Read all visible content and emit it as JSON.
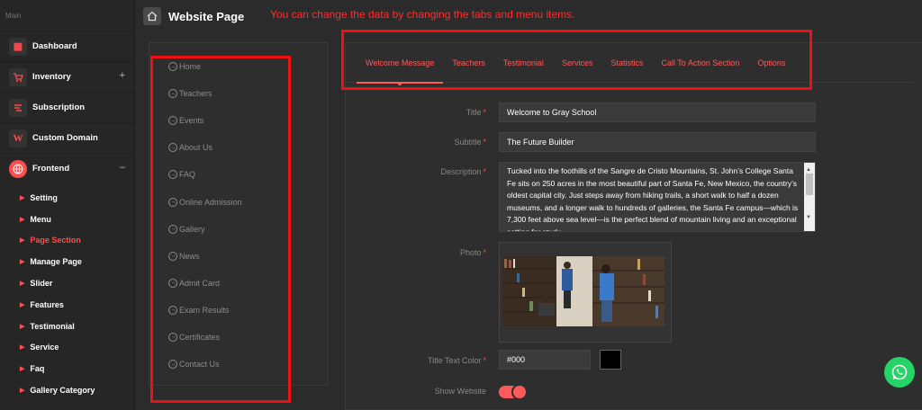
{
  "sidebar": {
    "section_label": "Main",
    "items": [
      {
        "label": "Dashboard",
        "icon": "dashboard-icon",
        "glyph": "▦"
      },
      {
        "label": "Inventory",
        "icon": "cart-icon",
        "glyph": "🛒",
        "toggle": "+"
      },
      {
        "label": "Subscription",
        "icon": "subscription-icon",
        "glyph": "⛭"
      },
      {
        "label": "Custom Domain",
        "icon": "w-logo-icon",
        "glyph": "W"
      },
      {
        "label": "Frontend",
        "icon": "globe-icon",
        "glyph": "⊕",
        "toggle": "–"
      }
    ],
    "sub_items": [
      "Setting",
      "Menu",
      "Page Section",
      "Manage Page",
      "Slider",
      "Features",
      "Testimonial",
      "Service",
      "Faq",
      "Gallery Category"
    ],
    "active_sub": "Page Section"
  },
  "header": {
    "title": "Website Page",
    "notice": "You can change the data by changing the tabs and menu items."
  },
  "menu": {
    "items": [
      "Home",
      "Teachers",
      "Events",
      "About Us",
      "FAQ",
      "Online Admission",
      "Gallery",
      "News",
      "Admit Card",
      "Exam Results",
      "Certificates",
      "Contact Us"
    ]
  },
  "tabs": {
    "items": [
      "Welcome Message",
      "Teachers",
      "Testimonial",
      "Services",
      "Statistics",
      "Call To Action Section",
      "Options"
    ],
    "active": "Welcome Message"
  },
  "form": {
    "title_label": "Title",
    "title_value": "Welcome to Gray School",
    "subtitle_label": "Subtitle",
    "subtitle_value": "The Future Builder",
    "description_label": "Description",
    "description_value": "Tucked into the foothills of the Sangre de Cristo Mountains, St. John’s College Santa Fe sits on 250 acres in the most beautiful part of Santa Fe, New Mexico, the country’s oldest capital city. Just steps away from hiking trails, a short walk to half a dozen museums, and a longer walk to hundreds of galleries, the Santa Fe campus—which is 7,300 feet above sea level—is the perfect blend of mountain living and an exceptional setting for study.",
    "photo_label": "Photo",
    "color_label": "Title Text Color",
    "color_value": "#000",
    "show_label": "Show Website",
    "show_enabled": true,
    "required_mark": "*"
  },
  "colors": {
    "accent": "#ff5a5a",
    "highlight": "#ee1111",
    "whatsapp": "#25d366",
    "swatch": "#000000"
  }
}
